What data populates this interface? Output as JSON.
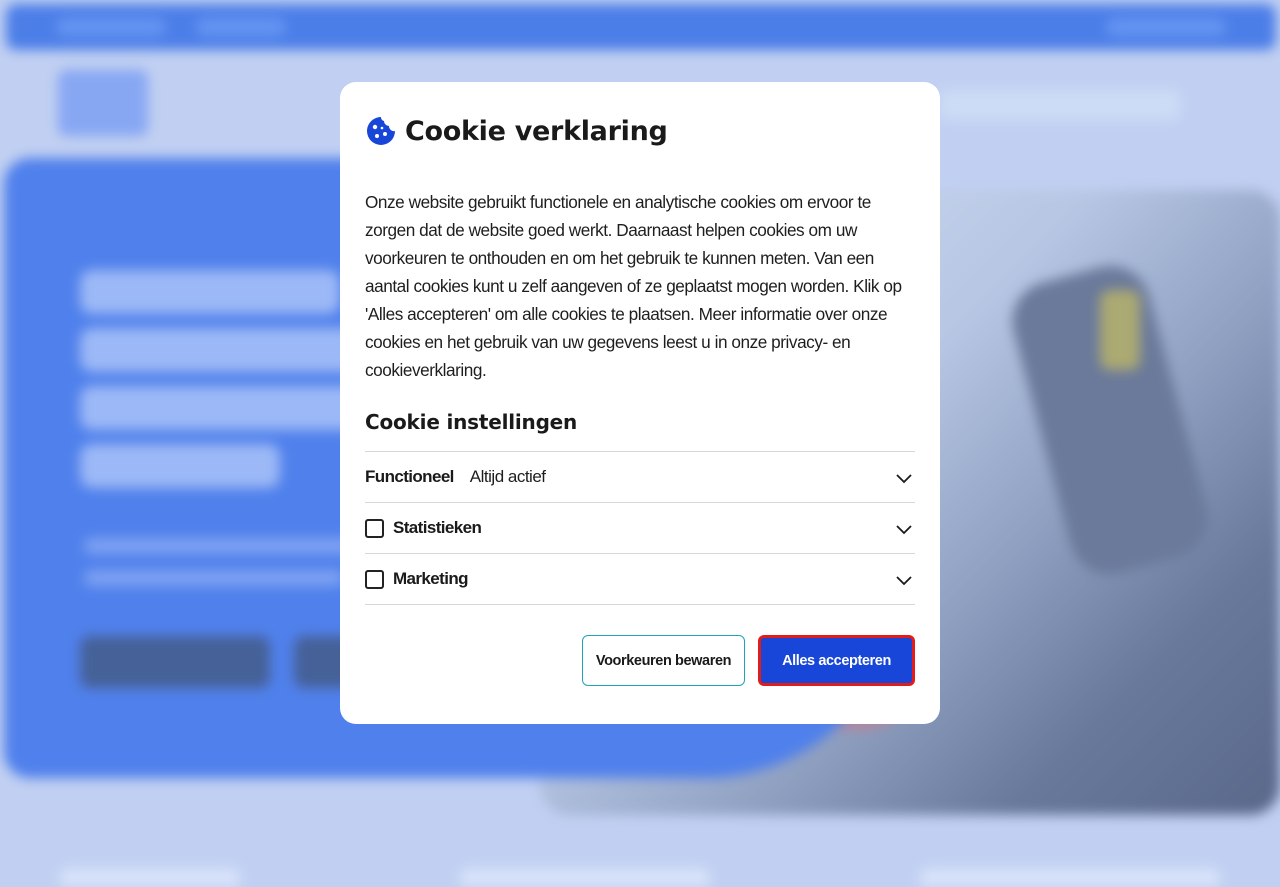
{
  "modal": {
    "title": "Cookie verklaring",
    "body": "Onze website gebruikt functionele en analytische cookies om ervoor te zorgen dat de website goed werkt. Daarnaast helpen cookies om uw voorkeuren te onthouden en om het gebruik te kunnen meten. Van een aantal cookies kunt u zelf aangeven of ze geplaatst mogen worden. Klik op 'Alles accepteren' om alle cookies te plaatsen. Meer informatie over onze cookies en het gebruik van uw gegevens leest u in onze privacy- en cookieverklaring.",
    "settings_title": "Cookie instellingen",
    "settings": [
      {
        "label": "Functioneel",
        "status": "Altijd actief",
        "checkbox": false
      },
      {
        "label": "Statistieken",
        "checkbox": true,
        "checked": false
      },
      {
        "label": "Marketing",
        "checkbox": true,
        "checked": false
      }
    ],
    "buttons": {
      "save_preferences": "Voorkeuren bewaren",
      "accept_all": "Alles accepteren"
    }
  },
  "colors": {
    "accent": "#1746d8",
    "focus_outline": "#e21b1b",
    "secondary_border": "#1fa3b8",
    "icon": "#1746d8"
  },
  "icons": {
    "title": "cookie-icon",
    "expand": "chevron-down-icon"
  }
}
